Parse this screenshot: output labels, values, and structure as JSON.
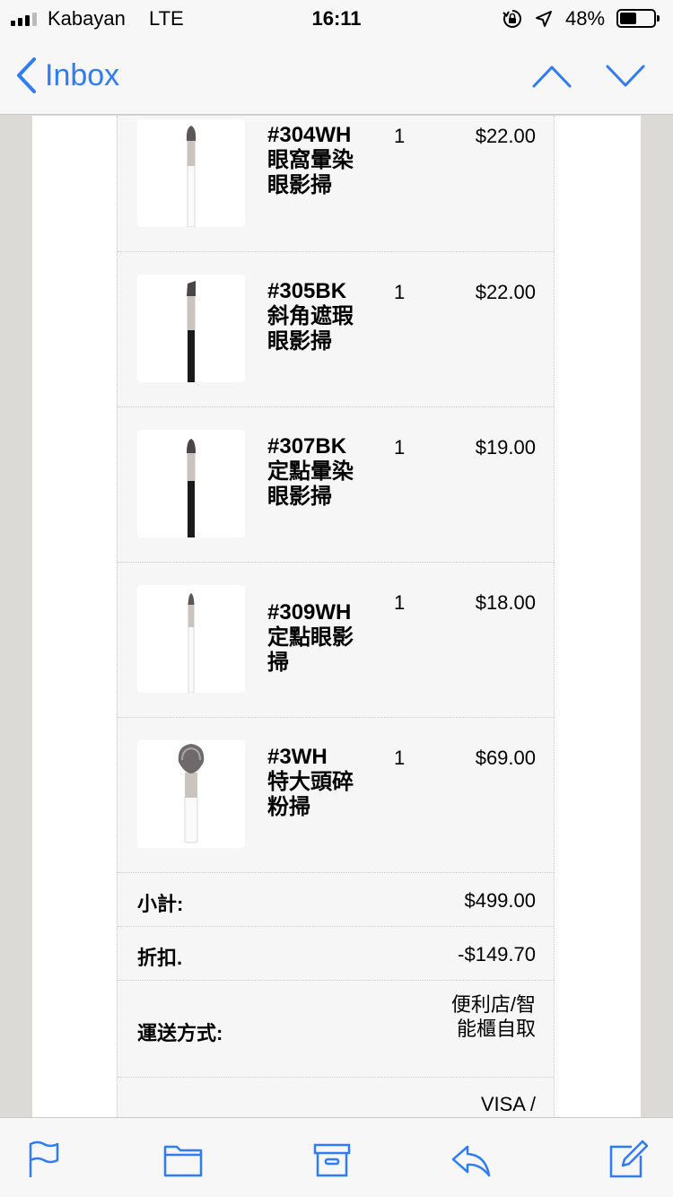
{
  "status_bar": {
    "carrier": "Kabayan",
    "network": "LTE",
    "time": "16:11",
    "battery": "48%",
    "battery_level": 0.48
  },
  "nav": {
    "back_label": "Inbox",
    "accent_color": "#2f7cf6"
  },
  "items": [
    {
      "name": "#304WH 眼窩暈染眼影掃",
      "qty": "1",
      "price": "$22.00",
      "handle_color": "#ffffff"
    },
    {
      "name": "#305BK 斜角遮瑕眼影掃",
      "qty": "1",
      "price": "$22.00",
      "handle_color": "#1a1a1a"
    },
    {
      "name": "#307BK 定點暈染眼影掃",
      "qty": "1",
      "price": "$19.00",
      "handle_color": "#1a1a1a"
    },
    {
      "name": "#309WH 定點眼影掃",
      "qty": "1",
      "price": "$18.00",
      "handle_color": "#ffffff"
    },
    {
      "name": "#3WH 特大頭碎粉掃",
      "qty": "1",
      "price": "$69.00",
      "handle_color": "#ffffff"
    }
  ],
  "summary": {
    "subtotal_label": "小計:",
    "subtotal_value": "$499.00",
    "discount_label": "折扣.",
    "discount_value": "-$149.70",
    "shipping_label": "運送方式:",
    "shipping_value": "便利店/智能櫃自取",
    "payment_value": "VISA /"
  },
  "toolbar": {
    "icons": [
      "flag-icon",
      "folder-icon",
      "archive-icon",
      "reply-icon",
      "compose-icon"
    ]
  }
}
